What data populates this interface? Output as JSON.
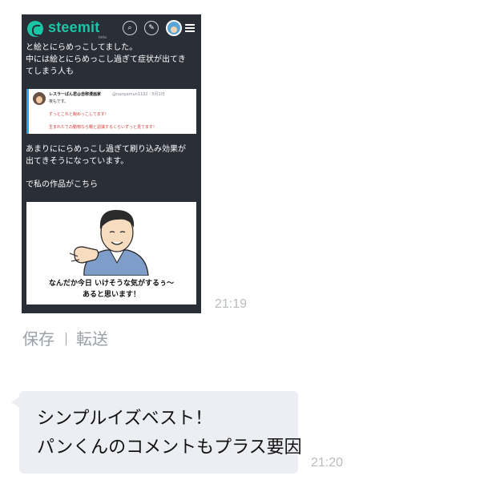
{
  "image_message": {
    "app_header": {
      "brand": "steemit",
      "sub": "beta"
    },
    "post_lines_top": [
      "と絵とにらめっこしてました。",
      "中には絵とにらめっこし過ぎて症状が出てき",
      "てしまう人も"
    ],
    "tweet": {
      "name": "レスラーぱん君@自称漫画家",
      "handle": "@nanpamun1102 · 5月1日",
      "lines": [
        "夜もです。",
        "ずっとこれと睨めっこしてます！",
        "生まれたての動物なら親と認識するくらいずっと見てます！"
      ]
    },
    "post_lines_mid": [
      "あまりににらめっこし過ぎて刷り込み効果が",
      "出てきそうになっています。",
      "",
      "で私の作品がこちら"
    ],
    "artwork_caption": [
      "なんだか今日 いけそうな気がするぅ〜",
      "あると思います！"
    ],
    "time": "21:19"
  },
  "actions": {
    "save": "保存",
    "forward": "転送"
  },
  "text_message": {
    "lines": [
      "シンプルイズベスト！",
      "パンくんのコメントもプラス要因"
    ],
    "time": "21:20"
  },
  "colors": {
    "brand": "#1ac6a6",
    "bubble": "#eceef3",
    "phone_bg": "#2a2e36"
  }
}
